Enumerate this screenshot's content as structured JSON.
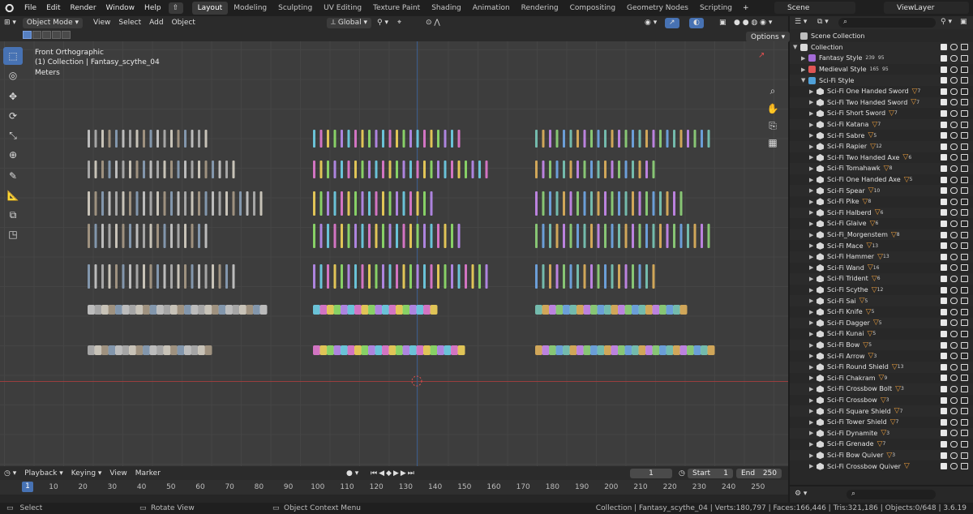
{
  "top_menu": [
    "File",
    "Edit",
    "Render",
    "Window",
    "Help"
  ],
  "workspace_tabs": [
    "Layout",
    "Modeling",
    "Sculpting",
    "UV Editing",
    "Texture Paint",
    "Shading",
    "Animation",
    "Rendering",
    "Compositing",
    "Geometry Nodes",
    "Scripting"
  ],
  "active_tab": "Layout",
  "add_tab_label": "+",
  "scene_name": "Scene",
  "view_layer": "ViewLayer",
  "viewport_header": {
    "mode": "Object Mode",
    "menus": [
      "View",
      "Select",
      "Add",
      "Object"
    ],
    "transform_orientation": "Global",
    "options": "Options"
  },
  "viewport_info": {
    "view": "Front Orthographic",
    "collection": "(1) Collection | Fantasy_scythe_04",
    "units": "Meters"
  },
  "timeline": {
    "menus": [
      "Playback",
      "Keying",
      "View",
      "Marker"
    ],
    "current_frame": "1",
    "start_label": "Start",
    "start": "1",
    "end_label": "End",
    "end": "250",
    "ticks": [
      "10",
      "20",
      "30",
      "40",
      "50",
      "60",
      "70",
      "80",
      "90",
      "100",
      "110",
      "120",
      "130",
      "140",
      "150",
      "160",
      "170",
      "180",
      "190",
      "200",
      "210",
      "220",
      "230",
      "240",
      "250"
    ]
  },
  "status": {
    "select": "Select",
    "rotate": "Rotate View",
    "context": "Object Context Menu",
    "stats": "Collection | Fantasy_scythe_04 | Verts:180,797 | Faces:166,446 | Tris:321,186 | Objects:0/648 | 3.6.19"
  },
  "outliner": {
    "root": "Scene Collection",
    "collection": "Collection",
    "groups": [
      {
        "name": "Fantasy Style",
        "color": "#a36bd6",
        "badges": [
          "239",
          "95"
        ]
      },
      {
        "name": "Medieval Style",
        "color": "#e05555",
        "badges": [
          "165",
          "95"
        ]
      },
      {
        "name": "Sci-Fi Style",
        "color": "#4fa0d8",
        "badges": []
      }
    ],
    "items": [
      {
        "name": "Sci-Fi One Handed Sword",
        "mods": "7"
      },
      {
        "name": "Sci-Fi Two Handed Sword",
        "mods": "7"
      },
      {
        "name": "Sci-Fi Short Sword",
        "mods": "7"
      },
      {
        "name": "Sci-Fi Katana",
        "mods": "7"
      },
      {
        "name": "Sci-Fi Sabre",
        "mods": "5"
      },
      {
        "name": "Sci-Fi Rapier",
        "mods": "12"
      },
      {
        "name": "Sci-Fi Two Handed Axe",
        "mods": "6"
      },
      {
        "name": "Sci-Fi Tomahawk",
        "mods": "8"
      },
      {
        "name": "Sci-Fi One Handed Axe",
        "mods": "5"
      },
      {
        "name": "Sci-Fi Spear",
        "mods": "10"
      },
      {
        "name": "Sci-Fi Pike",
        "mods": "8"
      },
      {
        "name": "Sci-Fi Halberd",
        "mods": "6"
      },
      {
        "name": "Sci-Fi Glaive",
        "mods": "6"
      },
      {
        "name": "Sci-Fi_Morgenstem",
        "mods": "8"
      },
      {
        "name": "Sci-Fi Mace",
        "mods": "13"
      },
      {
        "name": "Sci-Fi Hammer",
        "mods": "13"
      },
      {
        "name": "Sci-Fi Wand",
        "mods": "16"
      },
      {
        "name": "Sci-Fi Trident",
        "mods": "6"
      },
      {
        "name": "Sci-Fi Scythe",
        "mods": "12"
      },
      {
        "name": "Sci-Fi Sai",
        "mods": "5"
      },
      {
        "name": "Sci-Fi Knife",
        "mods": "5"
      },
      {
        "name": "Sci-Fi Dagger",
        "mods": "5"
      },
      {
        "name": "Sci-Fi Kunai",
        "mods": "5"
      },
      {
        "name": "Sci-Fi Bow",
        "mods": "5"
      },
      {
        "name": "Sci-Fi Arrow",
        "mods": "3"
      },
      {
        "name": "Sci-Fi Round Shield",
        "mods": "13"
      },
      {
        "name": "Sci-Fi Chakram",
        "mods": "9"
      },
      {
        "name": "Sci-Fi Crossbow Bolt",
        "mods": "3"
      },
      {
        "name": "Sci-Fi Crossbow",
        "mods": "3"
      },
      {
        "name": "Sci-Fi Square Shield",
        "mods": "7"
      },
      {
        "name": "Sci-Fi Tower Shield",
        "mods": "7"
      },
      {
        "name": "Sci-Fi Dynamite",
        "mods": "3"
      },
      {
        "name": "Sci-Fi Grenade",
        "mods": "7"
      },
      {
        "name": "Sci-Fi Bow Quiver",
        "mods": "3"
      },
      {
        "name": "Sci-Fi Crossbow Quiver",
        "mods": ""
      }
    ]
  },
  "colors": {
    "accent": "#4772b3",
    "selected_row": "#334d80",
    "modifier_icon": "#e59a3c"
  }
}
